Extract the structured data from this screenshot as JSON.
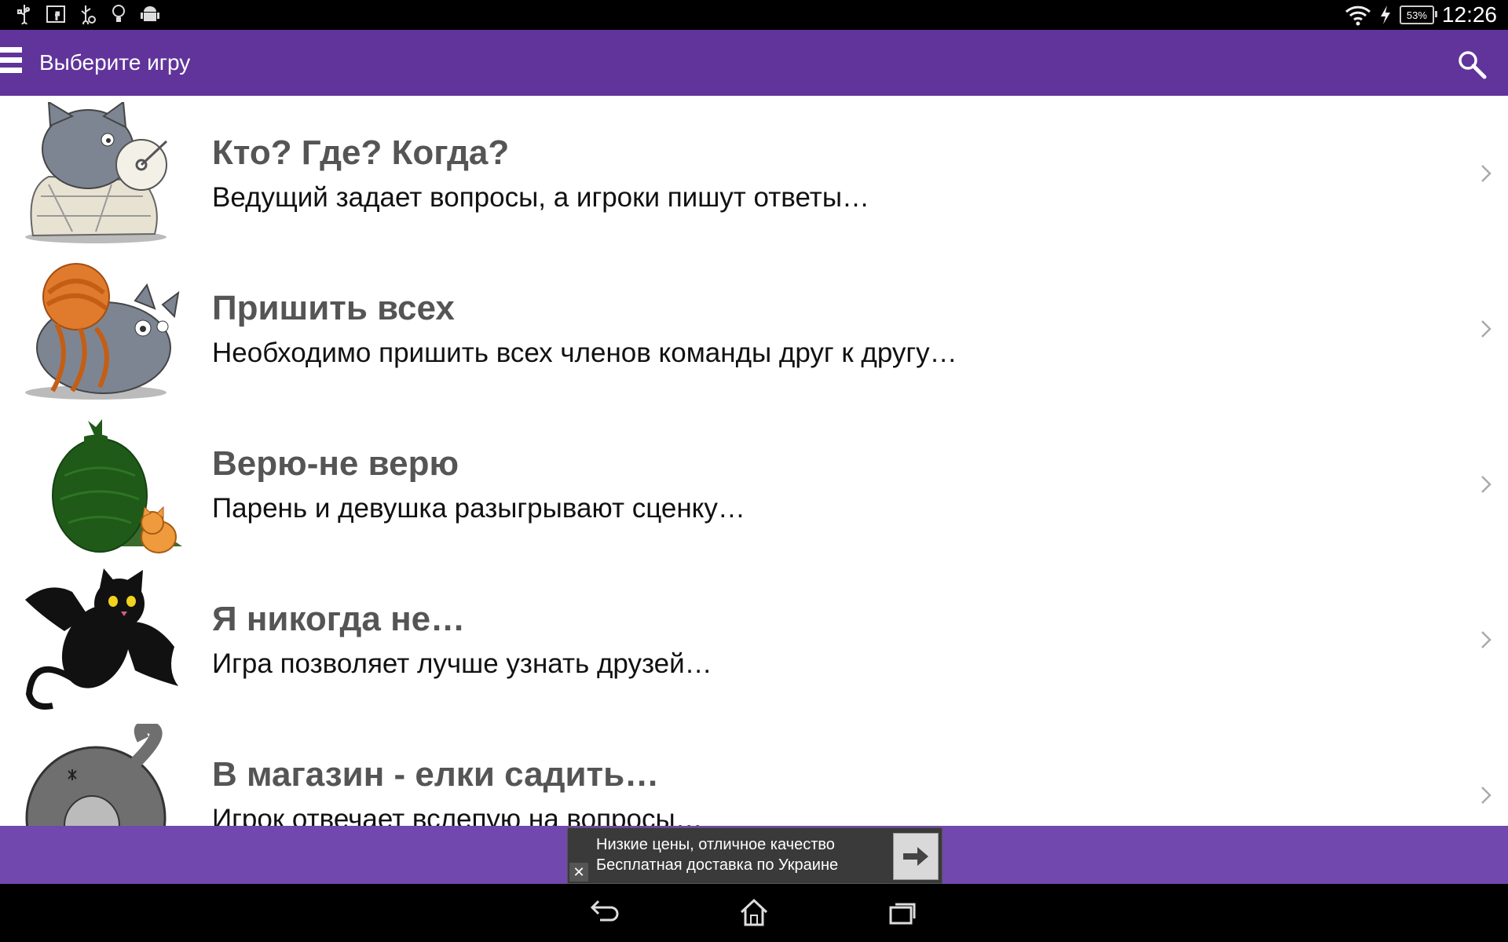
{
  "status_bar": {
    "battery": "53%",
    "time": "12:26",
    "left_icons": [
      "usb-icon",
      "facebook-notification-icon",
      "usb-debug-icon",
      "lightbulb-icon",
      "android-icon"
    ],
    "right_icons": [
      "wifi-icon",
      "charging-icon",
      "battery-icon"
    ]
  },
  "app_bar": {
    "title": "Выберите игру",
    "menu_icon": "hamburger-menu-icon",
    "search_icon": "search-icon",
    "color": "#60349a"
  },
  "games": [
    {
      "title": "Кто? Где? Когда?",
      "subtitle": "Ведущий задает вопросы, а игроки пишут ответы…",
      "icon": "cat-wrapped-in-thread-icon"
    },
    {
      "title": "Пришить всех",
      "subtitle": "Необходимо пришить всех членов команды друг к другу…",
      "icon": "cat-with-yarn-ball-icon"
    },
    {
      "title": "Верю-не верю",
      "subtitle": "Парень и девушка разыгрывают сценку…",
      "icon": "cats-with-green-yarn-icon"
    },
    {
      "title": "Я никогда не…",
      "subtitle": "Игра позволяет лучше узнать друзей…",
      "icon": "black-bat-cat-icon"
    },
    {
      "title": "В магазин - елки садить…",
      "subtitle": "Игрок отвечает вслепую на вопросы…",
      "icon": "grey-cat-back-icon"
    }
  ],
  "ad": {
    "line1": "Низкие цены, отличное качество",
    "line2": "Бесплатная доставка по Украине",
    "close": "✕",
    "arrow_icon": "arrow-right-icon"
  },
  "nav_bar": {
    "buttons": [
      "back-icon",
      "home-icon",
      "recent-apps-icon"
    ]
  }
}
